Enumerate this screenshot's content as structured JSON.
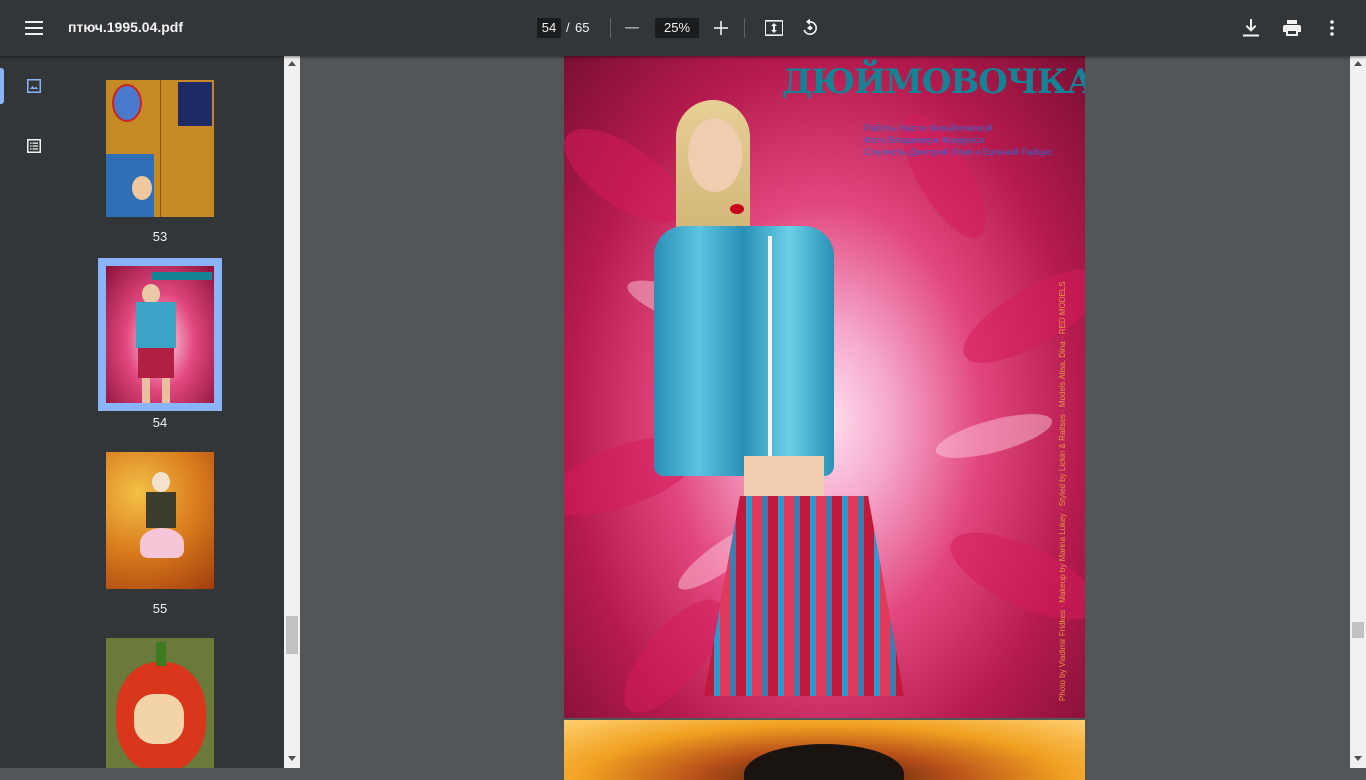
{
  "toolbar": {
    "title": "птюч.1995.04.pdf",
    "current_page": "54",
    "page_separator": "/",
    "total_pages": "65",
    "zoom": "25%"
  },
  "thumbnails": [
    {
      "label": "53"
    },
    {
      "label": "54",
      "selected": true
    },
    {
      "label": "55"
    },
    {
      "label": ""
    }
  ],
  "page": {
    "heading": "ДЮЙМОВОЧКА",
    "credits": [
      "Работы Насти Михайловской",
      "Фото Владимира Фридкеса",
      "Стилисты Дмитрий Лоик и Евгений Райцес"
    ],
    "vertical_credit": "Photo by Vladimir Fridkes · Makeup by Marina Lukey · Styled by Lickin & Raitses · Models Alisa, Dina · RED MODELS"
  },
  "colors": {
    "toolbar_bg": "#323639",
    "viewer_bg": "#525659",
    "accent": "#8ab4f8",
    "heading": "#138495"
  }
}
